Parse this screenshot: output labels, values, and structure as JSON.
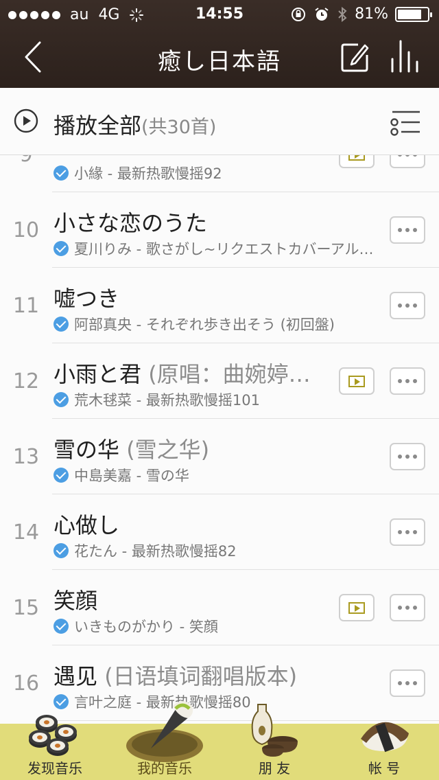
{
  "status_bar": {
    "carrier": "au",
    "network": "4G",
    "time": "14:55",
    "battery": "81%",
    "battery_level": 0.81
  },
  "nav": {
    "title": "癒し日本語",
    "back_icon": "chevron-left-icon",
    "edit_icon": "edit-icon",
    "equalizer_icon": "bars-icon"
  },
  "play_all": {
    "label": "播放全部",
    "count": "(共30首)",
    "icon": "play-circle-icon",
    "multiselect_icon": "list-select-icon"
  },
  "songs": [
    {
      "num": "9",
      "title": "",
      "alias": "",
      "artist_album": "小緣 - 最新热歌慢摇92",
      "has_mv": true
    },
    {
      "num": "10",
      "title": "小さな恋のうた",
      "alias": "",
      "artist_album": "夏川りみ - 歌さがし~リクエストカバーアルバム",
      "has_mv": false
    },
    {
      "num": "11",
      "title": "嘘つき",
      "alias": "",
      "artist_album": "阿部真央 - それぞれ歩き出そう (初回盤)",
      "has_mv": false
    },
    {
      "num": "12",
      "title": "小雨と君",
      "alias": " (原唱：曲婉婷…",
      "artist_album": "荒木毬菜 - 最新热歌慢摇101",
      "has_mv": true
    },
    {
      "num": "13",
      "title": "雪の华",
      "alias": " (雪之华)",
      "artist_album": "中島美嘉 - 雪の华",
      "has_mv": false
    },
    {
      "num": "14",
      "title": "心做し",
      "alias": "",
      "artist_album": "花たん - 最新热歌慢摇82",
      "has_mv": false
    },
    {
      "num": "15",
      "title": "笑顔",
      "alias": "",
      "artist_album": "いきものがかり - 笑顔",
      "has_mv": true
    },
    {
      "num": "16",
      "title": "遇见",
      "alias": " (日语填词翻唱版本)",
      "artist_album": "言叶之庭 - 最新热歌慢摇80",
      "has_mv": false
    }
  ],
  "tabs": [
    {
      "label": "发现音乐",
      "icon": "sushi-rolls-icon",
      "active": false
    },
    {
      "label": "我的音乐",
      "icon": "temaki-icon",
      "active": true
    },
    {
      "label": "朋 友",
      "icon": "sake-icon",
      "active": false
    },
    {
      "label": "帐 号",
      "icon": "nigiri-icon",
      "active": false
    }
  ],
  "colors": {
    "header_bg": "#2f231e",
    "tabbar_bg": "#e1dc7a",
    "check_blue": "#4c9ee3",
    "mv_olive": "#a99a1f"
  }
}
